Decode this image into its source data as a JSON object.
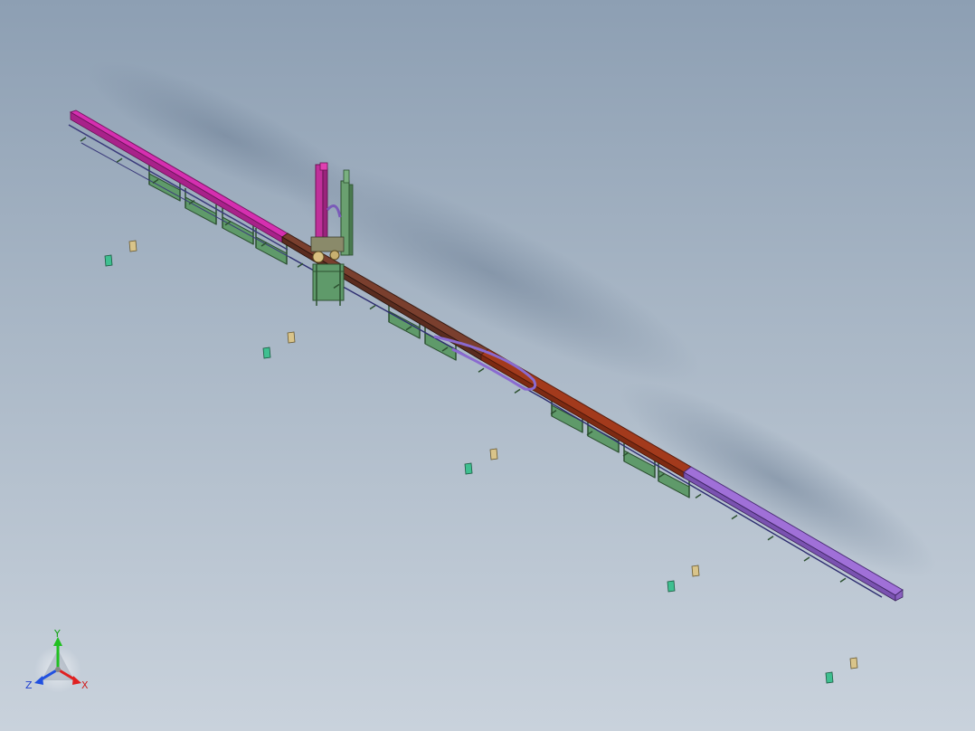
{
  "viewport": {
    "background_top": "#8d9fb3",
    "background_bottom": "#c9d2dc"
  },
  "model": {
    "colors": {
      "left_rail": "#d62fb0",
      "center_rail": "#6e3a2a",
      "red_rail": "#a33a1c",
      "right_rail": "#a070d8",
      "frame": "#4b7a4f",
      "frame_fill": "#5f9a6a",
      "mast": "#c0309a",
      "mast_green": "#6aa070",
      "cable": "#7a5ab8"
    }
  },
  "triad": {
    "x_label": "X",
    "y_label": "Y",
    "z_label": "Z",
    "x_color": "#e02020",
    "y_color": "#20c020",
    "z_color": "#2050e0"
  }
}
